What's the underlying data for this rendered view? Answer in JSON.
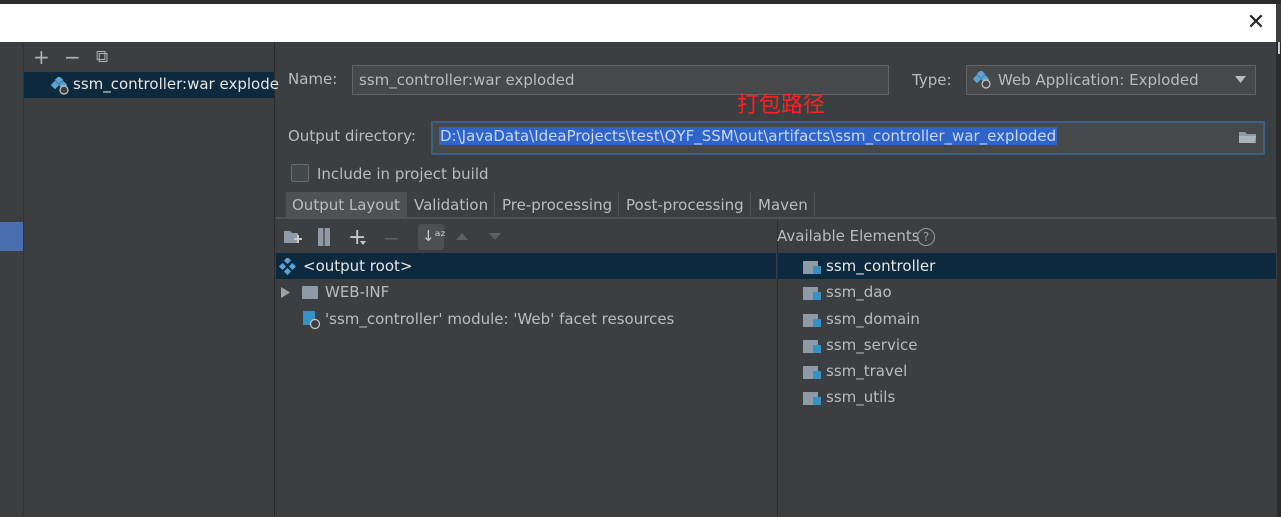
{
  "dialog": {
    "close_glyph": "✕"
  },
  "left_panel": {
    "toolbar": {
      "add": "+",
      "remove": "−",
      "copy": "⧉"
    },
    "artifacts": [
      {
        "label": "ssm_controller:war explode"
      }
    ]
  },
  "form": {
    "name_label": "Name:",
    "name_value": "ssm_controller:war exploded",
    "type_label": "Type:",
    "type_value": "Web Application: Exploded",
    "output_dir_label": "Output directory:",
    "output_dir_value": "D:\\JavaData\\IdeaProjects\\test\\QYF_SSM\\out\\artifacts\\ssm_controller_war_exploded",
    "include_build_label": "Include in project build",
    "include_build_checked": false,
    "annotation": "打包路径"
  },
  "tabs": [
    "Output Layout",
    "Validation",
    "Pre-processing",
    "Post-processing",
    "Maven"
  ],
  "output_layout": {
    "tree": [
      {
        "label": "<output root>",
        "icon": "output-root-icon",
        "selected": true
      },
      {
        "label": "WEB-INF",
        "icon": "folder-icon",
        "expandable": true
      },
      {
        "label": "'ssm_controller' module: 'Web' facet resources",
        "icon": "web-facet-icon"
      }
    ]
  },
  "available_elements": {
    "title": "Available Elements",
    "items": [
      "ssm_controller",
      "ssm_dao",
      "ssm_domain",
      "ssm_service",
      "ssm_travel",
      "ssm_utils"
    ]
  },
  "colors": {
    "background": "#3c3f41",
    "selection": "#0d293e",
    "annotation": "#ff2020",
    "text_selection": "#2f65ca"
  }
}
